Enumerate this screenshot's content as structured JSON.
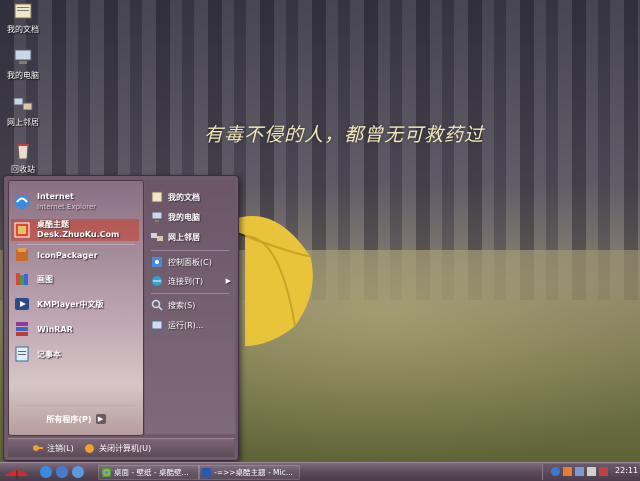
{
  "wallpaper": {
    "quote": "有毒不侵的人，都曾无可救药过"
  },
  "desktop_icons": [
    {
      "label": "我的文档",
      "icon": "my-documents-icon"
    },
    {
      "label": "我的电脑",
      "icon": "my-computer-icon"
    },
    {
      "label": "网上邻居",
      "icon": "network-places-icon"
    },
    {
      "label": "回收站",
      "icon": "recycle-bin-icon"
    }
  ],
  "start_menu": {
    "pinned": [
      {
        "title": "Internet",
        "subtitle": "Internet Explorer",
        "icon": "internet-explorer-icon"
      },
      {
        "title": "桌酷主题",
        "subtitle": "Desk.ZhuoKu.Com",
        "icon": "zhuoku-theme-icon"
      }
    ],
    "recent": [
      {
        "label": "IconPackager",
        "icon": "iconpackager-icon"
      },
      {
        "label": "画图",
        "icon": "paint-icon"
      },
      {
        "label": "KMPlayer中文版",
        "icon": "kmplayer-icon"
      },
      {
        "label": "WinRAR",
        "icon": "winrar-icon"
      },
      {
        "label": "记事本",
        "icon": "notepad-icon"
      }
    ],
    "all_programs": "所有程序(P)",
    "right": {
      "my_documents": "我的文档",
      "my_computer": "我的电脑",
      "network": "网上邻居",
      "control_panel": "控制面板(C)",
      "connect_to": "连接到(T)",
      "search": "搜索(S)",
      "run": "运行(R)..."
    },
    "logoff": "注销(L)",
    "shutdown": "关闭计算机(U)"
  },
  "taskbar": {
    "tasks": [
      {
        "label": "桌面 - 壁纸 - 桌酷壁...",
        "icon": "chrome-icon"
      },
      {
        "label": "-=>>桌酷主题 - Mic...",
        "icon": "word-icon"
      }
    ],
    "clock": "22:11"
  },
  "colors": {
    "accent": "#6e5a6a",
    "taskbar": "#5b4a5a",
    "selected": "#c83c28",
    "quote": "#f2e7b8"
  }
}
